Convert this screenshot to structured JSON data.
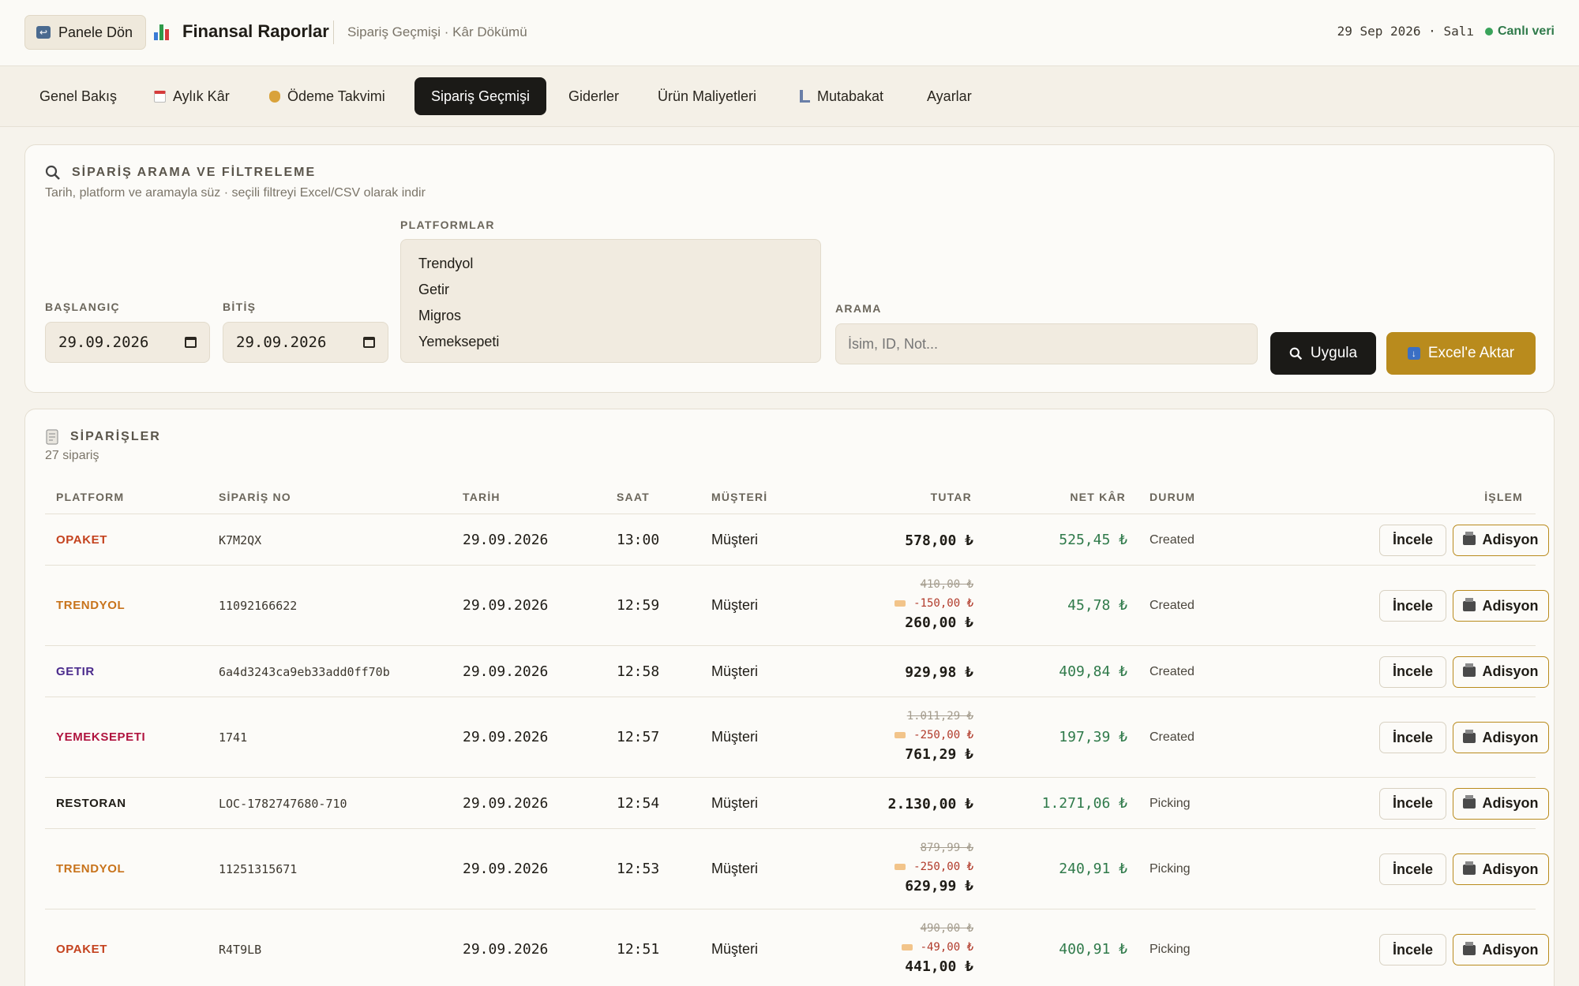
{
  "header": {
    "back_label": "Panele Dön",
    "title": "Finansal Raporlar",
    "subtitle": "Sipariş Geçmişi · Kâr Dökümü",
    "date": "29 Sep 2026 · Salı",
    "live_label": "Canlı veri"
  },
  "nav": {
    "tabs": [
      {
        "label": "Genel Bakış",
        "icon": ""
      },
      {
        "label": "Aylık Kâr",
        "icon": "calendar-icon"
      },
      {
        "label": "Ödeme Takvimi",
        "icon": "money-bag-icon"
      },
      {
        "label": "Sipariş Geçmişi",
        "icon": "",
        "active": true
      },
      {
        "label": "Giderler",
        "icon": ""
      },
      {
        "label": "Ürün Maliyetleri",
        "icon": ""
      },
      {
        "label": "Mutabakat",
        "icon": "microscope-icon"
      },
      {
        "label": "Ayarlar",
        "icon": ""
      }
    ]
  },
  "filter": {
    "heading": "SİPARİŞ ARAMA VE FİLTRELEME",
    "subtitle": "Tarih, platform ve aramayla süz · seçili filtreyi Excel/CSV olarak indir",
    "start_label": "BAŞLANGIÇ",
    "start_value": "29.09.2026",
    "end_label": "BİTİŞ",
    "end_value": "29.09.2026",
    "platforms_label": "PLATFORMLAR",
    "platforms": [
      "Trendyol",
      "Getir",
      "Migros",
      "Yemeksepeti"
    ],
    "search_label": "ARAMA",
    "search_placeholder": "İsim, ID, Not...",
    "apply_label": "Uygula",
    "export_label": "Excel'e Aktar"
  },
  "orders": {
    "heading": "SİPARİŞLER",
    "count_text": "27 sipariş",
    "columns": {
      "platform": "PLATFORM",
      "order_no": "SİPARİŞ NO",
      "date": "TARİH",
      "time": "SAAT",
      "customer": "MÜŞTERİ",
      "amount": "TUTAR",
      "net_profit": "NET KÂR",
      "status": "DURUM",
      "action": "İŞLEM"
    },
    "action_labels": {
      "inspect": "İncele",
      "receipt": "Adisyon"
    },
    "platform_colors": {
      "OPAKET": "#c4421e",
      "TRENDYOL": "#c8731b",
      "GETIR": "#4a2a8c",
      "YEMEKSEPETI": "#b0143f",
      "RESTORAN": "#1f1c16"
    },
    "rows": [
      {
        "platform": "OPAKET",
        "order_no": "K7M2QX",
        "date": "29.09.2026",
        "time": "13:00",
        "customer": "Müşteri",
        "amount": "578,00 ₺",
        "old_amount": "",
        "discount": "",
        "net": "525,45 ₺",
        "status": "Created"
      },
      {
        "platform": "TRENDYOL",
        "order_no": "11092166622",
        "date": "29.09.2026",
        "time": "12:59",
        "customer": "Müşteri",
        "amount": "260,00 ₺",
        "old_amount": "410,00 ₺",
        "discount": "-150,00 ₺",
        "net": "45,78 ₺",
        "status": "Created"
      },
      {
        "platform": "GETIR",
        "order_no": "6a4d3243ca9eb33add0ff70b",
        "date": "29.09.2026",
        "time": "12:58",
        "customer": "Müşteri",
        "amount": "929,98 ₺",
        "old_amount": "",
        "discount": "",
        "net": "409,84 ₺",
        "status": "Created"
      },
      {
        "platform": "YEMEKSEPETI",
        "order_no": "1741",
        "date": "29.09.2026",
        "time": "12:57",
        "customer": "Müşteri",
        "amount": "761,29 ₺",
        "old_amount": "1.011,29 ₺",
        "discount": "-250,00 ₺",
        "net": "197,39 ₺",
        "status": "Created"
      },
      {
        "platform": "RESTORAN",
        "order_no": "LOC-1782747680-710",
        "date": "29.09.2026",
        "time": "12:54",
        "customer": "Müşteri",
        "amount": "2.130,00 ₺",
        "old_amount": "",
        "discount": "",
        "net": "1.271,06 ₺",
        "status": "Picking"
      },
      {
        "platform": "TRENDYOL",
        "order_no": "11251315671",
        "date": "29.09.2026",
        "time": "12:53",
        "customer": "Müşteri",
        "amount": "629,99 ₺",
        "old_amount": "879,99 ₺",
        "discount": "-250,00 ₺",
        "net": "240,91 ₺",
        "status": "Picking"
      },
      {
        "platform": "OPAKET",
        "order_no": "R4T9LB",
        "date": "29.09.2026",
        "time": "12:51",
        "customer": "Müşteri",
        "amount": "441,00 ₺",
        "old_amount": "490,00 ₺",
        "discount": "-49,00 ₺",
        "net": "400,91 ₺",
        "status": "Picking"
      }
    ]
  }
}
